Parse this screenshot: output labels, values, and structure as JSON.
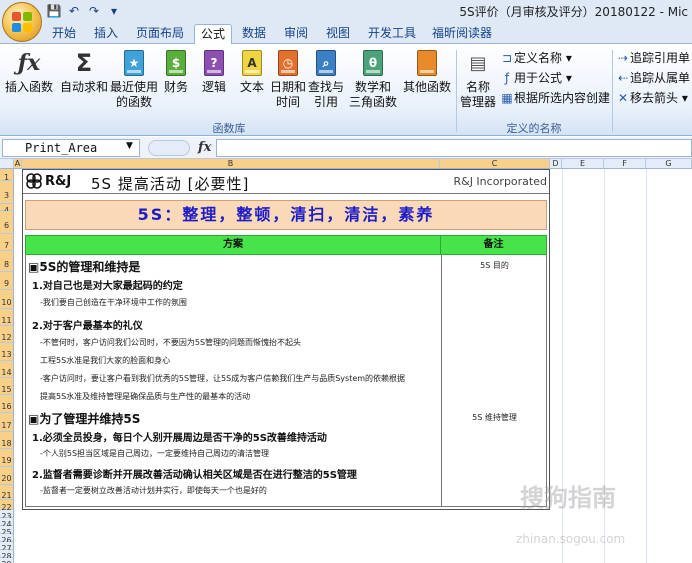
{
  "window": {
    "title": "5S评价（月审核及评分）20180122 - Mic"
  },
  "qat": {
    "save": "💾",
    "undo": "↶",
    "redo": "↷",
    "customize": "▾"
  },
  "tabs": [
    "开始",
    "插入",
    "页面布局",
    "公式",
    "数据",
    "审阅",
    "视图",
    "开发工具",
    "福昕阅读器"
  ],
  "active_tab": "公式",
  "ribbon": {
    "insert_function": "插入函数",
    "autosum": "自动求和",
    "recent": "最近使用",
    "recent2": "的函数",
    "financial": "财务",
    "logical": "逻辑",
    "text": "文本",
    "datetime": "日期和",
    "datetime2": "时间",
    "lookup": "查找与",
    "lookup2": "引用",
    "math": "数学和",
    "math2": "三角函数",
    "other": "其他函数",
    "group_library": "函数库",
    "name_manager": "名称",
    "name_manager2": "管理器",
    "define_name": "定义名称",
    "use_in_formula": "用于公式",
    "create_from_selection": "根据所选内容创建",
    "group_names": "定义的名称",
    "trace_precedents": "追踪引用单",
    "trace_dependents": "追踪从属单",
    "remove_arrows": "移去箭头"
  },
  "formula_bar": {
    "name_box": "Print_Area",
    "fx": "fx"
  },
  "columns": [
    "A",
    "B",
    "C",
    "D",
    "E",
    "F",
    "G"
  ],
  "rows": [
    "1",
    "3",
    "4",
    "6",
    "7",
    "8",
    "9",
    "10",
    "11",
    "12",
    "13",
    "14",
    "15",
    "16",
    "17",
    "18",
    "19",
    "20",
    "21",
    "22",
    "23",
    "24",
    "25",
    "26",
    "27",
    "28",
    "29"
  ],
  "doc": {
    "logo_text": "R&J",
    "title": "5S 提高活动 [必要性]",
    "company": "R&J Incorporated",
    "banner": "5S：整理，整顿，清扫，清洁，素养",
    "col_plan": "方案",
    "col_note": "备注",
    "lines": [
      "▣5S的管理和维持是",
      "1.对自己也是对大家最起码的约定",
      "-我们要自己创造在干净环境中工作的氛围",
      "2.对于客户最基本的礼仪",
      "-不管何时，客户访问我们公司时，不要因为5S管理的问题而惭愧抬不起头",
      " 工程5S水准是我们大家的脸面和身心",
      "-客户访问时，要让客户看到我们优秀的5S管理，让5S成为客户信赖我们生产与品质System的依赖根据",
      " 提高5S水准及维持管理是确保品质与生产性的最基本的活动",
      "▣为了管理并维持5S",
      "1.必须全员投身，每日个人别开展周边是否干净的5S改善维持活动",
      "-个人别5S担当区域是自己周边，一定要维持自己周边的清洁管理",
      "2.监督者需要诊断并开展改善活动确认相关区域是否在进行整洁的5S管理",
      "-监督者一定要树立改善活动计划并实行，即使每天一个也是好的"
    ],
    "note1": "5S 目的",
    "note2": "5S 维持管理"
  },
  "watermark": {
    "main": "搜狗指南",
    "sub": "zhinan.sogou.com"
  }
}
